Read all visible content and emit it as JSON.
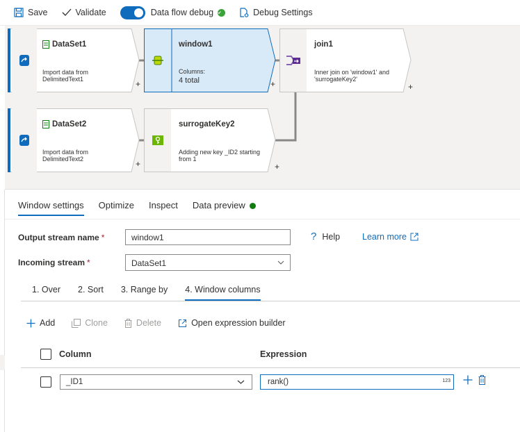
{
  "toolbar": {
    "save_label": "Save",
    "validate_label": "Validate",
    "debug_toggle_label": "Data flow debug",
    "debug_settings_label": "Debug Settings"
  },
  "graph": {
    "nodes": [
      {
        "id": "dataset1",
        "title": "DataSet1",
        "desc_line1": "Import data from",
        "desc_line2": "DelimitedText1",
        "icon": "source-icon"
      },
      {
        "id": "window1",
        "title": "window1",
        "desc_line1": "Columns:",
        "desc_line2": "4 total",
        "icon": "window-icon"
      },
      {
        "id": "join1",
        "title": "join1",
        "desc_line1": "Inner join on 'window1' and",
        "desc_line2": "'surrogateKey2'",
        "icon": "join-icon"
      },
      {
        "id": "dataset2",
        "title": "DataSet2",
        "desc_line1": "Import data from",
        "desc_line2": "DelimitedText2",
        "icon": "source-icon"
      },
      {
        "id": "surrogatekey2",
        "title": "surrogateKey2",
        "desc_line1": "Adding new key _ID2 starting",
        "desc_line2": "from 1",
        "icon": "surrogate-key-icon"
      }
    ],
    "plus_label": "+"
  },
  "tabs": [
    "Window settings",
    "Optimize",
    "Inspect",
    "Data preview"
  ],
  "form": {
    "output_stream_label": "Output stream name",
    "output_stream_value": "window1",
    "incoming_stream_label": "Incoming stream",
    "incoming_stream_value": "DataSet1",
    "required_mark": "*",
    "help_label": "Help",
    "learn_more_label": "Learn more"
  },
  "steps": [
    "1. Over",
    "2. Sort",
    "3. Range by",
    "4. Window columns"
  ],
  "actions": {
    "add_label": "Add",
    "clone_label": "Clone",
    "delete_label": "Delete",
    "expression_builder_label": "Open expression builder"
  },
  "table": {
    "column_header": "Column",
    "expression_header": "Expression",
    "rows": [
      {
        "column": "_ID1",
        "expression": "rank()",
        "type_badge": "123"
      }
    ]
  },
  "colors": {
    "accent": "#0f6cbd",
    "selected_node": "#d8e9f7",
    "success": "#3aa33a"
  }
}
